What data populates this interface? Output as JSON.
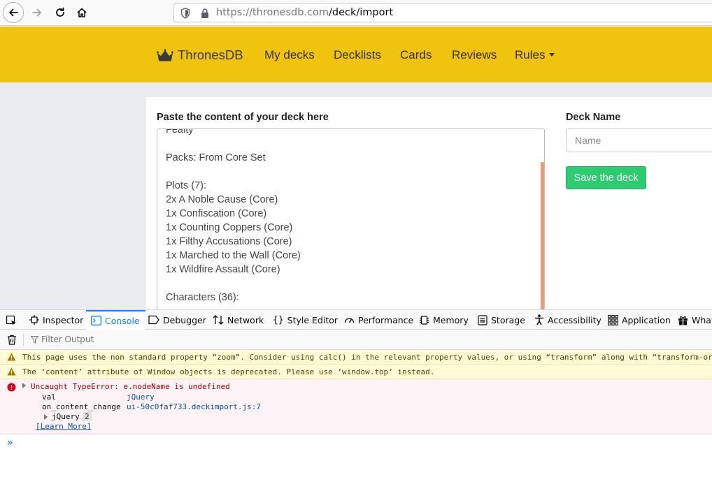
{
  "browser": {
    "url_host": "https://thronesdb.com",
    "url_path": "/deck/import",
    "icons": [
      "back-icon",
      "forward-icon",
      "reload-icon",
      "home-icon",
      "shield-icon",
      "lock-icon"
    ]
  },
  "site_nav": {
    "brand": "ThronesDB",
    "links": [
      "My decks",
      "Decklists",
      "Cards",
      "Reviews",
      "Rules"
    ],
    "accent_color": "#f0c30e"
  },
  "import_form": {
    "paste_label": "Paste the content of your deck here",
    "deck_lines": [
      "Fealty",
      "",
      "Packs: From Core Set",
      "",
      "Plots (7):",
      "2x A Noble Cause (Core)",
      "1x Confiscation (Core)",
      "1x Counting Coppers (Core)",
      "1x Filthy Accusations (Core)",
      "1x Marched to the Wall (Core)",
      "1x Wildfire Assault (Core)",
      "",
      "Characters (36):"
    ],
    "deck_name_label": "Deck Name",
    "deck_name_placeholder": "Name",
    "save_button": "Save the deck",
    "save_color": "#2ecc71"
  },
  "devtools": {
    "tabs": [
      "Inspector",
      "Console",
      "Debugger",
      "Network",
      "Style Editor",
      "Performance",
      "Memory",
      "Storage",
      "Accessibility",
      "Application",
      "What"
    ],
    "active_tab": "Console",
    "filter_placeholder": "Filter Output",
    "warnings": [
      "This page uses the non standard property “zoom”. Consider using calc() in the relevant property values, or using “transform” along with “transform-or",
      "The ‘content’ attribute of Window objects is deprecated.  Please use ‘window.top’ instead."
    ],
    "error": {
      "title": "Uncaught TypeError: e.nodeName is undefined",
      "stack": [
        {
          "fn": "val",
          "loc": "jQuery"
        },
        {
          "fn": "on_content_change",
          "loc": "ui-50c0faf733.deckimport.js:7"
        }
      ],
      "group_name": "jQuery",
      "group_count": "2",
      "learn_more": "[Learn More]"
    },
    "prompt": "»"
  }
}
